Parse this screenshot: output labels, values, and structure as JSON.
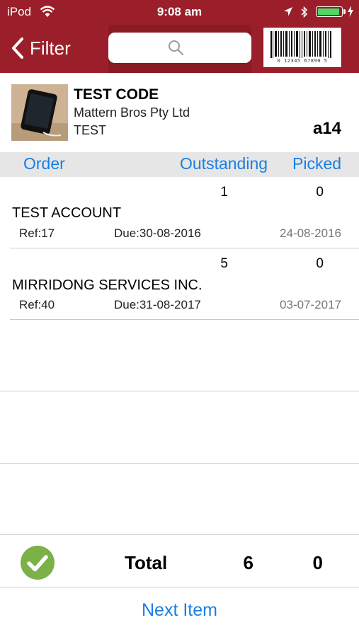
{
  "status": {
    "carrier": "iPod",
    "time": "9:08 am",
    "battery_level": 0.95,
    "battery_color": "#4cd964"
  },
  "nav": {
    "back_label": "Filter",
    "search_placeholder": "",
    "barcode_number": "0 12345 67890 5",
    "bar_color": "#9b1f2a"
  },
  "product": {
    "name": "TEST CODE",
    "supplier": "Mattern Bros Pty Ltd",
    "description": "TEST",
    "location": "a14"
  },
  "columns": {
    "order": "Order",
    "outstanding": "Outstanding",
    "picked": "Picked"
  },
  "orders": [
    {
      "outstanding": "1",
      "picked": "0",
      "account": "TEST ACCOUNT",
      "ref": "Ref:17",
      "due": "Due:30-08-2016",
      "date": "24-08-2016"
    },
    {
      "outstanding": "5",
      "picked": "0",
      "account": "MIRRIDONG SERVICES INC.",
      "ref": "Ref:40",
      "due": "Due:31-08-2017",
      "date": "03-07-2017"
    }
  ],
  "footer": {
    "total_label": "Total",
    "total_outstanding": "6",
    "total_picked": "0",
    "next_label": "Next Item",
    "accent_color": "#1a7fe3",
    "check_color": "#7bb148"
  }
}
